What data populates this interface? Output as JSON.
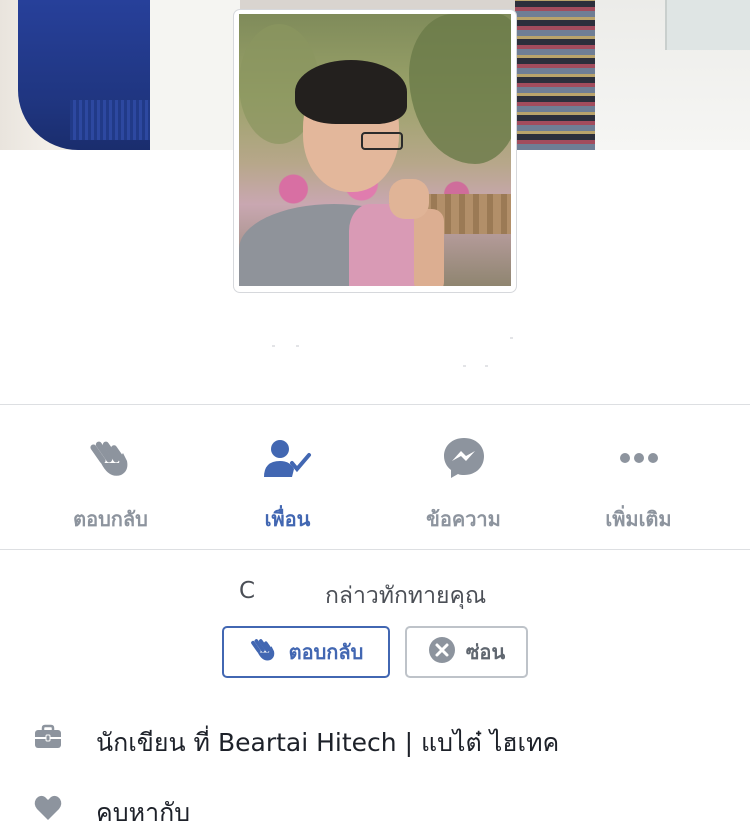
{
  "profile": {
    "cover": {
      "description_free": true
    },
    "avatar": {
      "description_free": true
    }
  },
  "actions": [
    {
      "label": "ตอบกลับ",
      "icon": "wave-icon",
      "active": false
    },
    {
      "label": "เพื่อน",
      "icon": "friends-check-icon",
      "active": true
    },
    {
      "label": "ข้อความ",
      "icon": "messenger-icon",
      "active": false
    },
    {
      "label": "เพิ่มเติม",
      "icon": "more-dots-icon",
      "active": false
    }
  ],
  "greeting": {
    "initial": "C",
    "text": "กล่าวทักทายคุณ",
    "wave_button_label": "ตอบกลับ",
    "hide_button_label": "ซ่อน"
  },
  "intro": {
    "work": "นักเขียน ที่ Beartai Hitech | แบไต๋ ไฮเทค",
    "relationship": "คบหากับ"
  },
  "colors": {
    "accent": "#4267b2",
    "muted_icon": "#8d949e",
    "text": "#1d2129",
    "divider": "#dddfe2"
  }
}
